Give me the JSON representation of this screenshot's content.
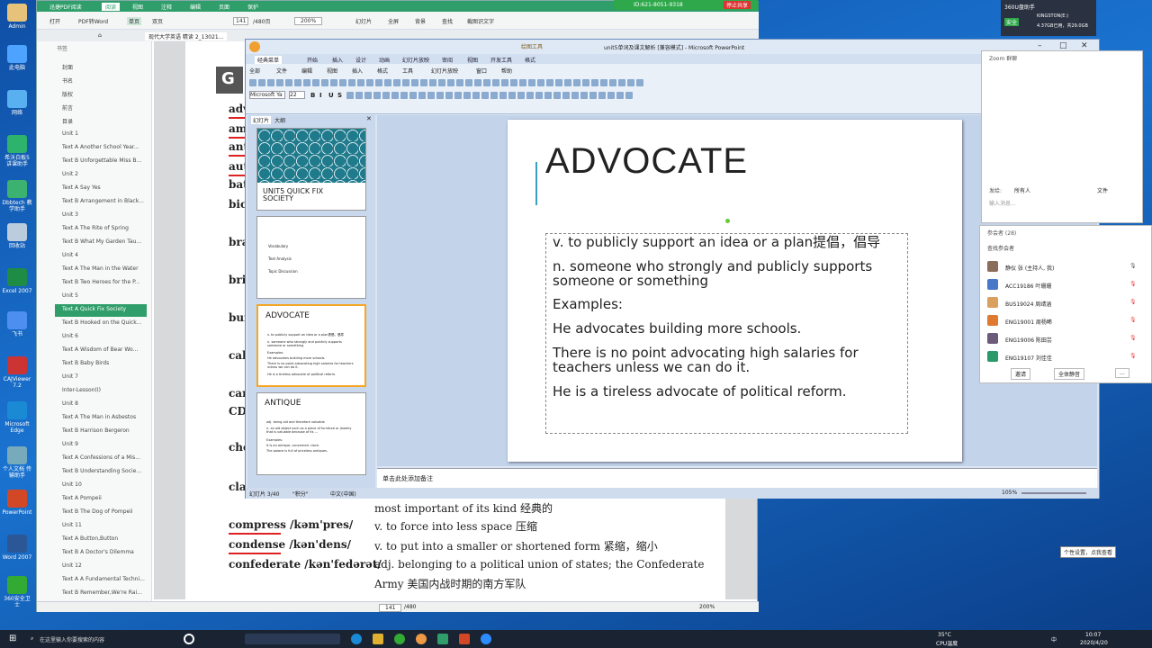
{
  "desktop": {
    "icons": [
      "Admin",
      "此电脑",
      "网络",
      "希沃白板5 讲课助手",
      "Dbbtech 教学助手",
      "回收站",
      "Excel 2007",
      "飞书",
      "CAJViewer 7.2",
      "Microsoft Edge",
      "个人文档 传输助手",
      "PowerPoint",
      "Word 2007",
      "360安全卫士"
    ]
  },
  "pdf": {
    "app_tab": "迅捷PDF阅读",
    "menu": [
      "阅读",
      "视图",
      "注释",
      "编辑",
      "页面",
      "保护"
    ],
    "toolbar": {
      "open": "打开",
      "to_word": "PDF转Word",
      "single": "单页",
      "double": "双页",
      "page_current": "141",
      "page_total": "/480页",
      "zoom": "200%",
      "slideshow": "幻灯片",
      "fullscreen": "全屏",
      "background": "背景",
      "find": "查找",
      "screenshot": "截图识文字"
    },
    "doc_tab": "现代大学英语 精读 2_13021...",
    "side_header": "书签",
    "toc": [
      "封面",
      "书名",
      "版权",
      "前言",
      "目录",
      "Unit 1",
      "Text A  Another School Year...",
      "Text B  Unforgettable Miss B...",
      "Unit 2",
      "Text A  Say Yes",
      "Text B  Arrangement in Black...",
      "Unit 3",
      "Text A  The Rite of Spring",
      "Text B  What My Garden Tau...",
      "Unit 4",
      "Text A  The Man in the Water",
      "Text B  Two Heroes for the P...",
      "Unit 5",
      "Text A  Quick Fix Society",
      "Text B  Hooked on the Quick...",
      "Unit 6",
      "Text A  Wisdom of Bear Wo...",
      "Text B  Baby Birds",
      "Unit 7",
      "Inter-Lesson(Ⅰ)",
      "Unit 8",
      "Text A  The Man in Asbestos",
      "Text B  Harrison Bergeron",
      "Unit 9",
      "Text A  Confessions of a Mis...",
      "Text B  Understanding Socie...",
      "Unit 10",
      "Text A  Pompeii",
      "Text B  The Dog of Pompeii",
      "Unit 11",
      "Text A  Button,Button",
      "Text B  A Doctor's Dilemma",
      "Unit 12",
      "Text A  A Fundamental Techni...",
      "Text B  Remember,We're Rai..."
    ],
    "page_left_words": [
      "G",
      "adv",
      "ame",
      "anti",
      "auto",
      "bat",
      "bicy",
      "bra",
      "brie",
      "bur",
      "cab",
      "care",
      "CD",
      "che",
      "clas"
    ],
    "entries": [
      {
        "word": "most important of its kind 经典的",
        "def": ""
      },
      {
        "word": "compress /kəm'pres/",
        "def": "v. to force into less space 压缩"
      },
      {
        "word": "condense /kən'dens/",
        "def": "v. to put into a smaller or shortened form 紧缩，缩小"
      },
      {
        "word": "confederate /kən'fedərət/",
        "def": "adj. belonging to a political union of states; the Confederate"
      },
      {
        "word": "",
        "def": "Army 美国内战时期的南方军队"
      }
    ],
    "status": {
      "page": "141",
      "total": "/480",
      "zoom": "200%"
    }
  },
  "ppt": {
    "title": "unit5单词及课文解析 [兼容模式] - Microsoft PowerPoint",
    "context_tab": "绘图工具",
    "tabs": [
      "经典菜单",
      "开始",
      "插入",
      "设计",
      "动画",
      "幻灯片放映",
      "审阅",
      "视图",
      "开发工具",
      "格式"
    ],
    "menus": [
      "全部",
      "文件",
      "编辑",
      "视图",
      "插入",
      "格式",
      "工具",
      "幻灯片放映",
      "窗口",
      "帮助"
    ],
    "font_name": "Microsoft Ya",
    "font_size": "22",
    "pane_tabs": [
      "幻灯片",
      "大纲"
    ],
    "thumbs": [
      {
        "num": "1",
        "title": "UNIT5 QUICK FIX SOCIETY"
      },
      {
        "num": "2",
        "lines": [
          "Vocabulary",
          "Text Analysis",
          "Topic Discussion"
        ]
      },
      {
        "num": "3",
        "title": "ADVOCATE",
        "lines": [
          "v. to publicly support an idea or a plan提倡，倡导",
          "n. someone who strongly and publicly supports someone or something",
          "Examples:",
          "He advocates building more schools.",
          "There is no point advocating high salaries for teachers unless we can do it.",
          "He is a tireless advocate of political reform."
        ]
      },
      {
        "num": "4",
        "title": "ANTIQUE",
        "lines": [
          "adj. being old and therefore valuable",
          "n. an old object such as a piece of furniture or jewelry that is valuable because of its ...",
          "Examples:",
          "It is an antique, concerned. clock.",
          "The palace is full of priceless antiques."
        ]
      }
    ],
    "slide": {
      "title": "ADVOCATE",
      "lines": [
        "v. to publicly support an idea or a plan提倡，倡导",
        "n. someone who strongly and publicly supports someone or something",
        "Examples:",
        "He advocates building more schools.",
        "There is no point advocating high salaries for teachers unless we can do it.",
        "He is a tireless advocate of political reform."
      ]
    },
    "notes_placeholder": "单击此处添加备注",
    "status": {
      "slide": "幻灯片 3/40",
      "theme": "\"积分\"",
      "lang": "中文(中国)",
      "zoom": "105%"
    }
  },
  "meeting_bar": {
    "id": "ID:621-8051-9318",
    "stop": "停止共享"
  },
  "usb": {
    "title": "360U盘助手",
    "drive": "KINGSTON(E:)",
    "info": "4.37GB已用，共29.0GB",
    "safe": "安全"
  },
  "zoom_chat": {
    "title": "Zoom 群聊",
    "send_to_label": "发给:",
    "send_to_value": "所有人",
    "file": "文件",
    "input_placeholder": "输入消息..."
  },
  "zoom_participants": {
    "title": "参会者 (28)",
    "search_placeholder": "查找参会者",
    "list": [
      {
        "name": "静仪 张 (主持人, 我)",
        "color": "#8a6d5a"
      },
      {
        "name": "ACC19186 叶珊珊",
        "color": "#4a78c8"
      },
      {
        "name": "BUS19024 周靖涵",
        "color": "#d9a060"
      },
      {
        "name": "ENG19001 周杨晞",
        "color": "#e07a30"
      },
      {
        "name": "ENG19006 陈田芸",
        "color": "#6b5a7a"
      },
      {
        "name": "ENG19107 刘佳佳",
        "color": "#2a9a6a"
      }
    ],
    "invite": "邀请",
    "mute_all": "全体静音",
    "more": "..."
  },
  "tooltip": "个性设置，点我查看",
  "taskbar": {
    "search": "在这里输入你要搜索的内容",
    "weather": "35°C",
    "weather_sub": "CPU温度",
    "ime": "中",
    "time": "10:07",
    "date": "2020/4/20"
  }
}
